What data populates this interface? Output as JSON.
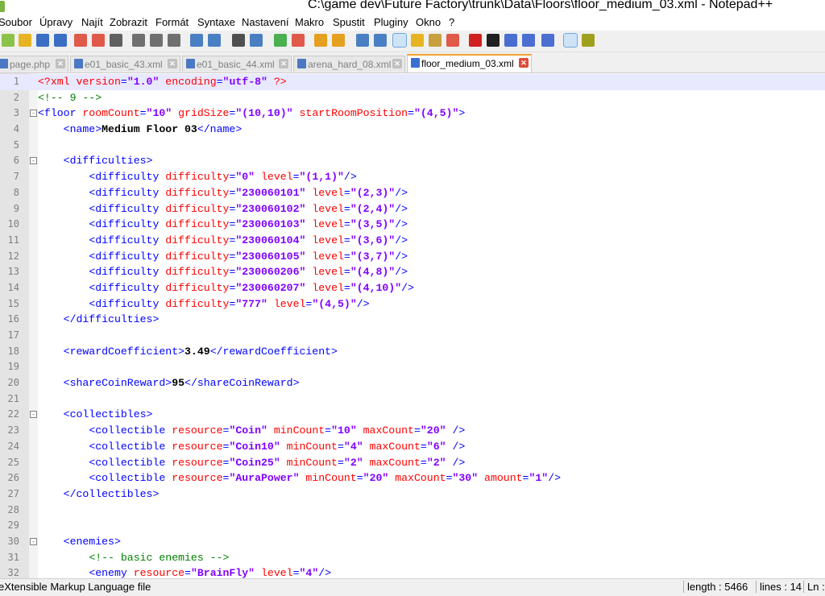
{
  "window": {
    "title": "C:\\game dev\\Future Factory\\trunk\\Data\\Floors\\floor_medium_03.xml - Notepad++"
  },
  "menu": [
    "Soubor",
    "Úpravy",
    "Najít",
    "Zobrazit",
    "Formát",
    "Syntaxe",
    "Nastavení",
    "Makro",
    "Spustit",
    "Pluginy",
    "Okno",
    "?"
  ],
  "toolbar": {
    "icons": [
      "new-file-icon",
      "open-file-icon",
      "save-icon",
      "save-all-icon",
      "close-icon",
      "close-all-icon",
      "print-icon",
      "cut-icon",
      "copy-icon",
      "paste-icon",
      "undo-icon",
      "redo-icon",
      "find-icon",
      "replace-icon",
      "zoom-in-icon",
      "zoom-out-icon",
      "sync-vertical-icon",
      "sync-horizontal-icon",
      "word-wrap-icon",
      "show-all-chars-icon",
      "indent-guide-icon",
      "user-lang-icon",
      "doc-map-icon",
      "function-list-icon",
      "record-macro-icon",
      "stop-record-icon",
      "play-macro-icon",
      "run-macro-multiple-icon",
      "save-macro-icon",
      "spell-check-icon",
      "plugin-icon"
    ],
    "colors": [
      "#8bc34a",
      "#e6b422",
      "#3a6fc4",
      "#3a6fc4",
      "#e05a4a",
      "#e05a4a",
      "#606060",
      "#707070",
      "#707070",
      "#707070",
      "#4a7fc4",
      "#4a7fc4",
      "#505050",
      "#4a7fc4",
      "#4caf50",
      "#e05a4a",
      "#e6a020",
      "#e6a020",
      "#4a7fc4",
      "#4a7fc4",
      "#3a6fc4",
      "#e6b422",
      "#c8a040",
      "#e05a4a",
      "#d02020",
      "#202020",
      "#4a6fd0",
      "#4a6fd0",
      "#4a6fd0",
      "#c04040",
      "#a0a020"
    ]
  },
  "tabs": [
    {
      "label": "page.php",
      "active": false
    },
    {
      "label": "e01_basic_43.xml",
      "active": false
    },
    {
      "label": "e01_basic_44.xml",
      "active": false
    },
    {
      "label": "arena_hard_08.xml",
      "active": false
    },
    {
      "label": "floor_medium_03.xml",
      "active": true
    }
  ],
  "editor": {
    "lines": [
      {
        "n": "1",
        "tokens": [
          [
            "pi",
            "<?xml "
          ],
          [
            "attr",
            "version"
          ],
          [
            "tag",
            "="
          ],
          [
            "val",
            "\"1.0\""
          ],
          [
            "attr",
            " encoding"
          ],
          [
            "tag",
            "="
          ],
          [
            "val",
            "\"utf-8\""
          ],
          [
            "pi",
            " ?>"
          ]
        ]
      },
      {
        "n": "2",
        "tokens": [
          [
            "com",
            "<!-- 9 -->"
          ]
        ]
      },
      {
        "n": "3",
        "fold": "-",
        "tokens": [
          [
            "tag",
            "<floor"
          ],
          [
            "attr",
            " roomCount"
          ],
          [
            "tag",
            "="
          ],
          [
            "val",
            "\"10\""
          ],
          [
            "attr",
            " gridSize"
          ],
          [
            "tag",
            "="
          ],
          [
            "val",
            "\"(10,10)\""
          ],
          [
            "attr",
            " startRoomPosition"
          ],
          [
            "tag",
            "="
          ],
          [
            "val",
            "\"(4,5)\""
          ],
          [
            "tag",
            ">"
          ]
        ]
      },
      {
        "n": "4",
        "tokens": [
          [
            "plain",
            "    "
          ],
          [
            "tag",
            "<name>"
          ],
          [
            "text",
            "Medium Floor 03"
          ],
          [
            "tag",
            "</name>"
          ]
        ]
      },
      {
        "n": "5",
        "tokens": []
      },
      {
        "n": "6",
        "fold": "-",
        "tokens": [
          [
            "plain",
            "    "
          ],
          [
            "tag",
            "<difficulties>"
          ]
        ]
      },
      {
        "n": "7",
        "tokens": [
          [
            "plain",
            "        "
          ],
          [
            "tag",
            "<difficulty"
          ],
          [
            "attr",
            " difficulty"
          ],
          [
            "tag",
            "="
          ],
          [
            "val",
            "\"0\""
          ],
          [
            "attr",
            " level"
          ],
          [
            "tag",
            "="
          ],
          [
            "val",
            "\"(1,1)\""
          ],
          [
            "tag",
            "/>"
          ]
        ]
      },
      {
        "n": "8",
        "tokens": [
          [
            "plain",
            "        "
          ],
          [
            "tag",
            "<difficulty"
          ],
          [
            "attr",
            " difficulty"
          ],
          [
            "tag",
            "="
          ],
          [
            "val",
            "\"230060101\""
          ],
          [
            "attr",
            " level"
          ],
          [
            "tag",
            "="
          ],
          [
            "val",
            "\"(2,3)\""
          ],
          [
            "tag",
            "/>"
          ]
        ]
      },
      {
        "n": "9",
        "tokens": [
          [
            "plain",
            "        "
          ],
          [
            "tag",
            "<difficulty"
          ],
          [
            "attr",
            " difficulty"
          ],
          [
            "tag",
            "="
          ],
          [
            "val",
            "\"230060102\""
          ],
          [
            "attr",
            " level"
          ],
          [
            "tag",
            "="
          ],
          [
            "val",
            "\"(2,4)\""
          ],
          [
            "tag",
            "/>"
          ]
        ]
      },
      {
        "n": "10",
        "tokens": [
          [
            "plain",
            "        "
          ],
          [
            "tag",
            "<difficulty"
          ],
          [
            "attr",
            " difficulty"
          ],
          [
            "tag",
            "="
          ],
          [
            "val",
            "\"230060103\""
          ],
          [
            "attr",
            " level"
          ],
          [
            "tag",
            "="
          ],
          [
            "val",
            "\"(3,5)\""
          ],
          [
            "tag",
            "/>"
          ]
        ]
      },
      {
        "n": "11",
        "tokens": [
          [
            "plain",
            "        "
          ],
          [
            "tag",
            "<difficulty"
          ],
          [
            "attr",
            " difficulty"
          ],
          [
            "tag",
            "="
          ],
          [
            "val",
            "\"230060104\""
          ],
          [
            "attr",
            " level"
          ],
          [
            "tag",
            "="
          ],
          [
            "val",
            "\"(3,6)\""
          ],
          [
            "tag",
            "/>"
          ]
        ]
      },
      {
        "n": "12",
        "tokens": [
          [
            "plain",
            "        "
          ],
          [
            "tag",
            "<difficulty"
          ],
          [
            "attr",
            " difficulty"
          ],
          [
            "tag",
            "="
          ],
          [
            "val",
            "\"230060105\""
          ],
          [
            "attr",
            " level"
          ],
          [
            "tag",
            "="
          ],
          [
            "val",
            "\"(3,7)\""
          ],
          [
            "tag",
            "/>"
          ]
        ]
      },
      {
        "n": "13",
        "tokens": [
          [
            "plain",
            "        "
          ],
          [
            "tag",
            "<difficulty"
          ],
          [
            "attr",
            " difficulty"
          ],
          [
            "tag",
            "="
          ],
          [
            "val",
            "\"230060206\""
          ],
          [
            "attr",
            " level"
          ],
          [
            "tag",
            "="
          ],
          [
            "val",
            "\"(4,8)\""
          ],
          [
            "tag",
            "/>"
          ]
        ]
      },
      {
        "n": "14",
        "tokens": [
          [
            "plain",
            "        "
          ],
          [
            "tag",
            "<difficulty"
          ],
          [
            "attr",
            " difficulty"
          ],
          [
            "tag",
            "="
          ],
          [
            "val",
            "\"230060207\""
          ],
          [
            "attr",
            " level"
          ],
          [
            "tag",
            "="
          ],
          [
            "val",
            "\"(4,10)\""
          ],
          [
            "tag",
            "/>"
          ]
        ]
      },
      {
        "n": "15",
        "tokens": [
          [
            "plain",
            "        "
          ],
          [
            "tag",
            "<difficulty"
          ],
          [
            "attr",
            " difficulty"
          ],
          [
            "tag",
            "="
          ],
          [
            "val",
            "\"777\""
          ],
          [
            "attr",
            " level"
          ],
          [
            "tag",
            "="
          ],
          [
            "val",
            "\"(4,5)\""
          ],
          [
            "tag",
            "/>"
          ]
        ]
      },
      {
        "n": "16",
        "tokens": [
          [
            "plain",
            "    "
          ],
          [
            "tag",
            "</difficulties>"
          ]
        ]
      },
      {
        "n": "17",
        "tokens": []
      },
      {
        "n": "18",
        "tokens": [
          [
            "plain",
            "    "
          ],
          [
            "tag",
            "<rewardCoefficient>"
          ],
          [
            "text",
            "3.49"
          ],
          [
            "tag",
            "</rewardCoefficient>"
          ]
        ]
      },
      {
        "n": "19",
        "tokens": []
      },
      {
        "n": "20",
        "tokens": [
          [
            "plain",
            "    "
          ],
          [
            "tag",
            "<shareCoinReward>"
          ],
          [
            "text",
            "95"
          ],
          [
            "tag",
            "</shareCoinReward>"
          ]
        ]
      },
      {
        "n": "21",
        "tokens": []
      },
      {
        "n": "22",
        "fold": "-",
        "tokens": [
          [
            "plain",
            "    "
          ],
          [
            "tag",
            "<collectibles>"
          ]
        ]
      },
      {
        "n": "23",
        "tokens": [
          [
            "plain",
            "        "
          ],
          [
            "tag",
            "<collectible"
          ],
          [
            "attr",
            " resource"
          ],
          [
            "tag",
            "="
          ],
          [
            "val",
            "\"Coin\""
          ],
          [
            "attr",
            " minCount"
          ],
          [
            "tag",
            "="
          ],
          [
            "val",
            "\"10\""
          ],
          [
            "attr",
            " maxCount"
          ],
          [
            "tag",
            "="
          ],
          [
            "val",
            "\"20\""
          ],
          [
            "tag",
            " />"
          ]
        ]
      },
      {
        "n": "24",
        "tokens": [
          [
            "plain",
            "        "
          ],
          [
            "tag",
            "<collectible"
          ],
          [
            "attr",
            " resource"
          ],
          [
            "tag",
            "="
          ],
          [
            "val",
            "\"Coin10\""
          ],
          [
            "attr",
            " minCount"
          ],
          [
            "tag",
            "="
          ],
          [
            "val",
            "\"4\""
          ],
          [
            "attr",
            " maxCount"
          ],
          [
            "tag",
            "="
          ],
          [
            "val",
            "\"6\""
          ],
          [
            "tag",
            " />"
          ]
        ]
      },
      {
        "n": "25",
        "tokens": [
          [
            "plain",
            "        "
          ],
          [
            "tag",
            "<collectible"
          ],
          [
            "attr",
            " resource"
          ],
          [
            "tag",
            "="
          ],
          [
            "val",
            "\"Coin25\""
          ],
          [
            "attr",
            " minCount"
          ],
          [
            "tag",
            "="
          ],
          [
            "val",
            "\"2\""
          ],
          [
            "attr",
            " maxCount"
          ],
          [
            "tag",
            "="
          ],
          [
            "val",
            "\"2\""
          ],
          [
            "tag",
            " />"
          ]
        ]
      },
      {
        "n": "26",
        "tokens": [
          [
            "plain",
            "        "
          ],
          [
            "tag",
            "<collectible"
          ],
          [
            "attr",
            " resource"
          ],
          [
            "tag",
            "="
          ],
          [
            "val",
            "\"AuraPower\""
          ],
          [
            "attr",
            " minCount"
          ],
          [
            "tag",
            "="
          ],
          [
            "val",
            "\"20\""
          ],
          [
            "attr",
            " maxCount"
          ],
          [
            "tag",
            "="
          ],
          [
            "val",
            "\"30\""
          ],
          [
            "attr",
            " amount"
          ],
          [
            "tag",
            "="
          ],
          [
            "val",
            "\"1\""
          ],
          [
            "tag",
            "/>"
          ]
        ]
      },
      {
        "n": "27",
        "tokens": [
          [
            "plain",
            "    "
          ],
          [
            "tag",
            "</collectibles>"
          ]
        ]
      },
      {
        "n": "28",
        "tokens": []
      },
      {
        "n": "29",
        "tokens": []
      },
      {
        "n": "30",
        "fold": "-",
        "tokens": [
          [
            "plain",
            "    "
          ],
          [
            "tag",
            "<enemies>"
          ]
        ]
      },
      {
        "n": "31",
        "tokens": [
          [
            "plain",
            "        "
          ],
          [
            "com",
            "<!-- basic enemies -->"
          ]
        ]
      },
      {
        "n": "32",
        "tokens": [
          [
            "plain",
            "        "
          ],
          [
            "tag",
            "<enemy"
          ],
          [
            "attr",
            " resource"
          ],
          [
            "tag",
            "="
          ],
          [
            "val",
            "\"BrainFly\""
          ],
          [
            "attr",
            " level"
          ],
          [
            "tag",
            "="
          ],
          [
            "val",
            "\"4\""
          ],
          [
            "tag",
            "/>"
          ]
        ]
      }
    ]
  },
  "status": {
    "file_type": "eXtensible Markup Language file",
    "length": "length : 5466",
    "lines": "lines : 14",
    "ln": "Ln :"
  }
}
